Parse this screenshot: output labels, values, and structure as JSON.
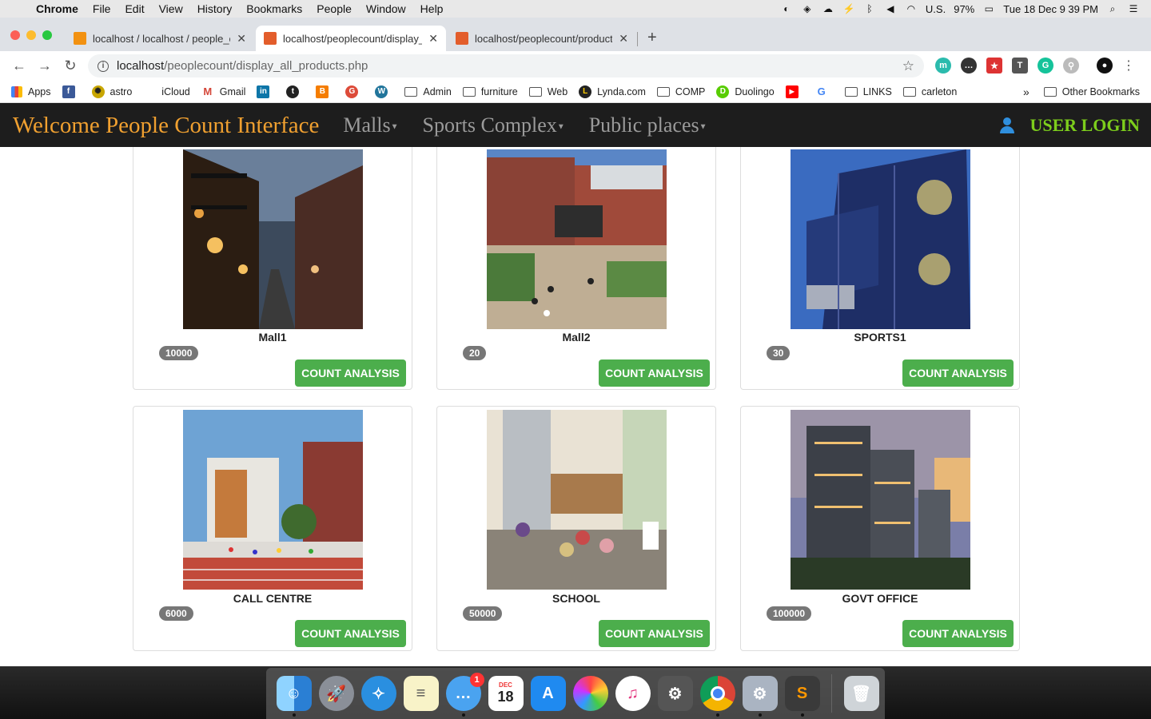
{
  "menubar": {
    "app_name": "Chrome",
    "items": [
      "File",
      "Edit",
      "View",
      "History",
      "Bookmarks",
      "People",
      "Window",
      "Help"
    ],
    "keyboard": "U.S.",
    "battery": "97%",
    "clock": "Tue 18 Dec  9 39 PM"
  },
  "tabs": [
    {
      "title": "localhost / localhost / people_c",
      "icon_color": "#f29111"
    },
    {
      "title": "localhost/peoplecount/display_",
      "icon_color": "#e35d2b"
    },
    {
      "title": "localhost/peoplecount/product",
      "icon_color": "#e35d2b"
    }
  ],
  "address": {
    "host": "localhost",
    "path": "/peoplecount/display_all_products.php"
  },
  "bookmarks": [
    {
      "label": "Apps",
      "kind": "grid-icon"
    },
    {
      "label": "",
      "kind": "facebook-icon",
      "color": "#3b5998",
      "glyph": "f"
    },
    {
      "label": "astro",
      "kind": "astro-icon",
      "color": "#222",
      "glyph": "✺"
    },
    {
      "label": "iCloud",
      "kind": "apple-icon",
      "color": "#666",
      "glyph": ""
    },
    {
      "label": "Gmail",
      "kind": "gmail-icon",
      "color": "#d44638",
      "glyph": "M"
    },
    {
      "label": "",
      "kind": "linkedin-icon",
      "color": "#0e76a8",
      "glyph": "in"
    },
    {
      "label": "",
      "kind": "tumblr-icon",
      "color": "#222",
      "glyph": "t"
    },
    {
      "label": "",
      "kind": "blogger-icon",
      "color": "#f57d00",
      "glyph": "B"
    },
    {
      "label": "",
      "kind": "google-plus-icon",
      "color": "#dd4b39",
      "glyph": "G"
    },
    {
      "label": "",
      "kind": "wordpress-icon",
      "color": "#21759b",
      "glyph": "W"
    },
    {
      "label": "Admin",
      "kind": "folder-icon"
    },
    {
      "label": "furniture",
      "kind": "folder-icon"
    },
    {
      "label": "Web",
      "kind": "folder-icon"
    },
    {
      "label": "Lynda.com",
      "kind": "lynda-icon",
      "color": "#222",
      "glyph": "L"
    },
    {
      "label": "COMP",
      "kind": "folder-icon"
    },
    {
      "label": "Duolingo",
      "kind": "duolingo-icon",
      "color": "#58cc02",
      "glyph": "D"
    },
    {
      "label": "",
      "kind": "youtube-icon",
      "color": "#ff0000",
      "glyph": "▶"
    },
    {
      "label": "",
      "kind": "google-icon",
      "color": "#4285f4",
      "glyph": "G"
    },
    {
      "label": "LINKS",
      "kind": "folder-icon"
    },
    {
      "label": "carleton",
      "kind": "folder-icon"
    }
  ],
  "bookmarks_more": "»",
  "other_bookmarks": "Other Bookmarks",
  "navbar": {
    "brand": "Welcome People Count Interface",
    "links": [
      "Malls",
      "Sports Complex",
      "Public places"
    ],
    "login": "USER LOGIN"
  },
  "products": [
    {
      "name": "Mall1",
      "count": "10000",
      "button": "COUNT ANALYSIS",
      "scene": "street-night"
    },
    {
      "name": "Mall2",
      "count": "20",
      "button": "COUNT ANALYSIS",
      "scene": "campus"
    },
    {
      "name": "SPORTS1",
      "count": "30",
      "button": "COUNT ANALYSIS",
      "scene": "containers"
    },
    {
      "name": "CALL CENTRE",
      "count": "6000",
      "button": "COUNT ANALYSIS",
      "scene": "track"
    },
    {
      "name": "SCHOOL",
      "count": "50000",
      "button": "COUNT ANALYSIS",
      "scene": "library"
    },
    {
      "name": "GOVT OFFICE",
      "count": "100000",
      "button": "COUNT ANALYSIS",
      "scene": "towers"
    }
  ],
  "dock": {
    "messages_badge": "1",
    "calendar_month": "DEC",
    "calendar_day": "18"
  }
}
